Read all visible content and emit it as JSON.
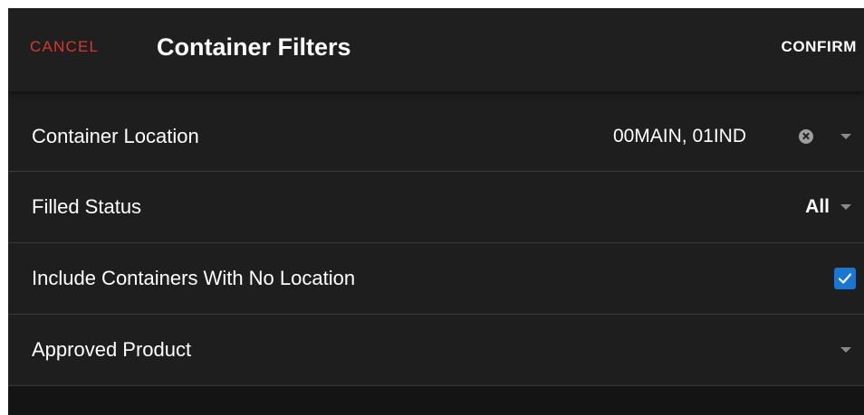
{
  "header": {
    "cancel_label": "CANCEL",
    "title": "Container Filters",
    "confirm_label": "CONFIRM"
  },
  "filters": [
    {
      "label": "Container Location",
      "value": "00MAIN, 01IND",
      "control": "multi-select",
      "clear_icon": "clear-circle-icon",
      "dropdown_icon": "chevron-down-icon"
    },
    {
      "label": "Filled Status",
      "value": "All",
      "control": "select",
      "dropdown_icon": "chevron-down-icon"
    },
    {
      "label": "Include Containers With No Location",
      "checked": true,
      "control": "checkbox"
    },
    {
      "label": "Approved Product",
      "value": "",
      "control": "select",
      "dropdown_icon": "chevron-down-icon"
    }
  ],
  "colors": {
    "background": "#1e1e1e",
    "header_background": "#1f1f1f",
    "cancel": "#d8392b",
    "text": "#ffffff",
    "divider": "#3a3a3a",
    "checkbox": "#1976d2",
    "icon": "#8a8a8a"
  }
}
